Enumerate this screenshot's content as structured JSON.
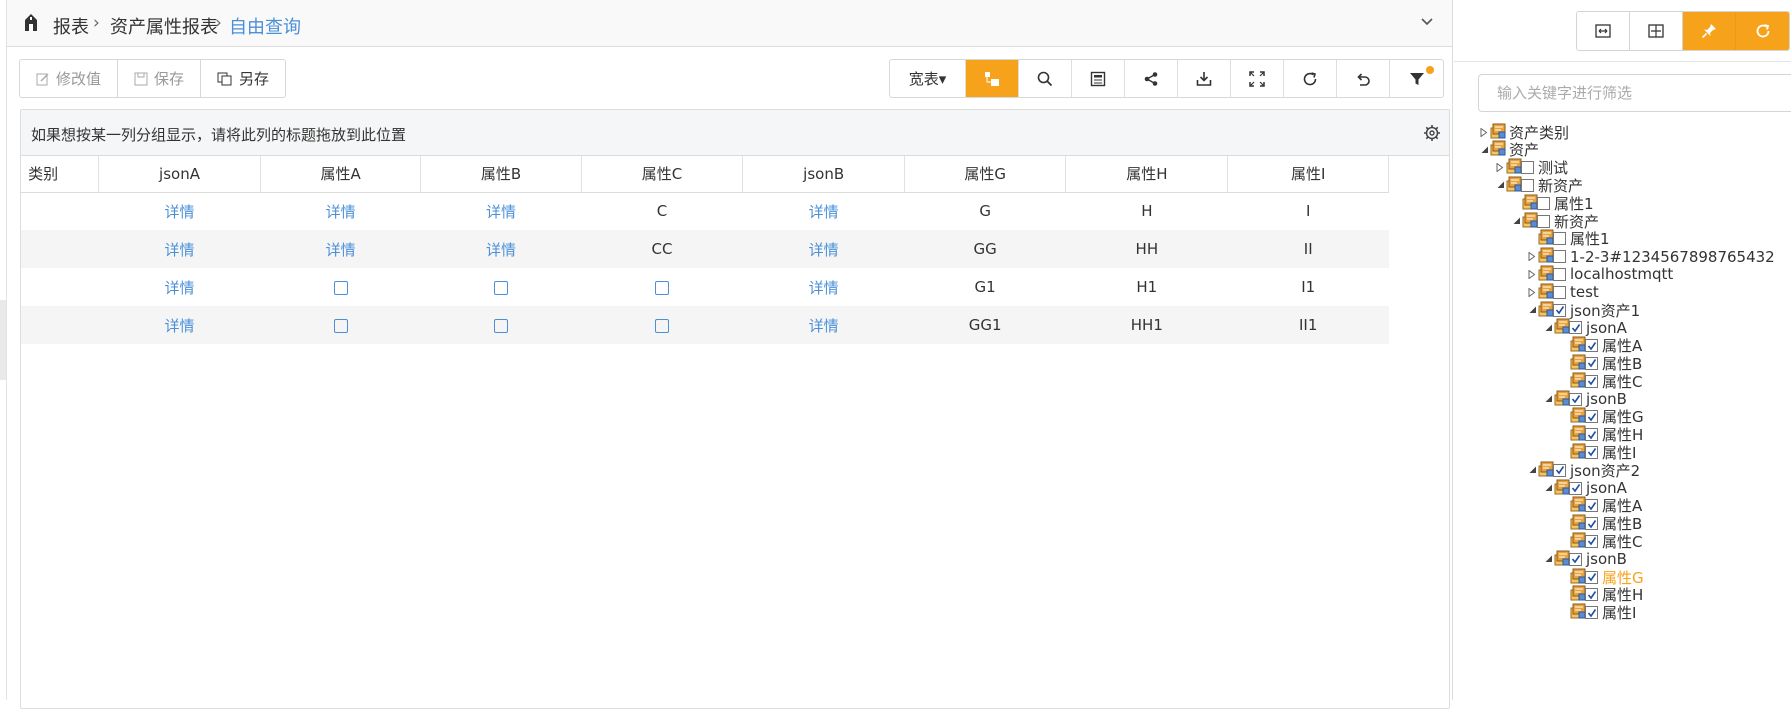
{
  "breadcrumb": {
    "root": "报表",
    "sep1": "›",
    "middle": "资产属性报表",
    "sep2": "›",
    "current": "自由查询"
  },
  "toolbar_left": {
    "modify": "修改值",
    "save": "保存",
    "save_as": "另存"
  },
  "toolbar_right": {
    "view_mode": "宽表▾"
  },
  "grid": {
    "group_hint": "如果想按某一列分组显示，请将此列的标题拖放到此位置",
    "columns": [
      "类别",
      "jsonA",
      "属性A",
      "属性B",
      "属性C",
      "jsonB",
      "属性G",
      "属性H",
      "属性I"
    ],
    "rows": [
      [
        "",
        "详情",
        "详情",
        "详情",
        "C",
        "详情",
        "G",
        "H",
        "I"
      ],
      [
        "",
        "详情",
        "详情",
        "详情",
        "CC",
        "详情",
        "GG",
        "HH",
        "II"
      ],
      [
        "",
        "详情",
        "☐",
        "☐",
        "☐",
        "详情",
        "G1",
        "H1",
        "I1"
      ],
      [
        "",
        "详情",
        "☐",
        "☐",
        "☐",
        "详情",
        "GG1",
        "HH1",
        "II1"
      ]
    ]
  },
  "right_panel": {
    "filter_placeholder": "输入关键字进行筛选",
    "tree": [
      {
        "label": "资产类别",
        "checkbox": false,
        "checked": false,
        "expander": "collapsed"
      },
      {
        "label": "资产",
        "checkbox": false,
        "checked": false,
        "expander": "expanded"
      },
      {
        "label": "测试",
        "checkbox": true,
        "checked": false,
        "expander": "collapsed"
      },
      {
        "label": "新资产",
        "checkbox": true,
        "checked": false,
        "expander": "expanded"
      },
      {
        "label": "属性1",
        "checkbox": true,
        "checked": false,
        "expander": "none"
      },
      {
        "label": "新资产",
        "checkbox": true,
        "checked": false,
        "expander": "expanded"
      },
      {
        "label": "属性1",
        "checkbox": true,
        "checked": false,
        "expander": "none"
      },
      {
        "label": "1-2-3#1234567898765432",
        "checkbox": true,
        "checked": false,
        "expander": "collapsed"
      },
      {
        "label": "localhostmqtt",
        "checkbox": true,
        "checked": false,
        "expander": "collapsed"
      },
      {
        "label": "test",
        "checkbox": true,
        "checked": false,
        "expander": "collapsed"
      },
      {
        "label": "json资产1",
        "checkbox": true,
        "checked": true,
        "expander": "expanded"
      },
      {
        "label": "jsonA",
        "checkbox": true,
        "checked": true,
        "expander": "expanded"
      },
      {
        "label": "属性A",
        "checkbox": true,
        "checked": true,
        "expander": "none"
      },
      {
        "label": "属性B",
        "checkbox": true,
        "checked": true,
        "expander": "none"
      },
      {
        "label": "属性C",
        "checkbox": true,
        "checked": true,
        "expander": "none"
      },
      {
        "label": "jsonB",
        "checkbox": true,
        "checked": true,
        "expander": "expanded"
      },
      {
        "label": "属性G",
        "checkbox": true,
        "checked": true,
        "expander": "none"
      },
      {
        "label": "属性H",
        "checkbox": true,
        "checked": true,
        "expander": "none"
      },
      {
        "label": "属性I",
        "checkbox": true,
        "checked": true,
        "expander": "none"
      },
      {
        "label": "json资产2",
        "checkbox": true,
        "checked": true,
        "expander": "expanded"
      },
      {
        "label": "jsonA",
        "checkbox": true,
        "checked": true,
        "expander": "expanded"
      },
      {
        "label": "属性A",
        "checkbox": true,
        "checked": true,
        "expander": "none"
      },
      {
        "label": "属性B",
        "checkbox": true,
        "checked": true,
        "expander": "none"
      },
      {
        "label": "属性C",
        "checkbox": true,
        "checked": true,
        "expander": "none"
      },
      {
        "label": "jsonB",
        "checkbox": true,
        "checked": true,
        "expander": "expanded"
      },
      {
        "label": "属性G",
        "checkbox": true,
        "checked": true,
        "expander": "none",
        "highlight": true
      },
      {
        "label": "属性H",
        "checkbox": true,
        "checked": true,
        "expander": "none"
      },
      {
        "label": "属性I",
        "checkbox": true,
        "checked": true,
        "expander": "none"
      }
    ]
  },
  "colors": {
    "accent": "#f7a21b",
    "link": "#4a90d9"
  }
}
